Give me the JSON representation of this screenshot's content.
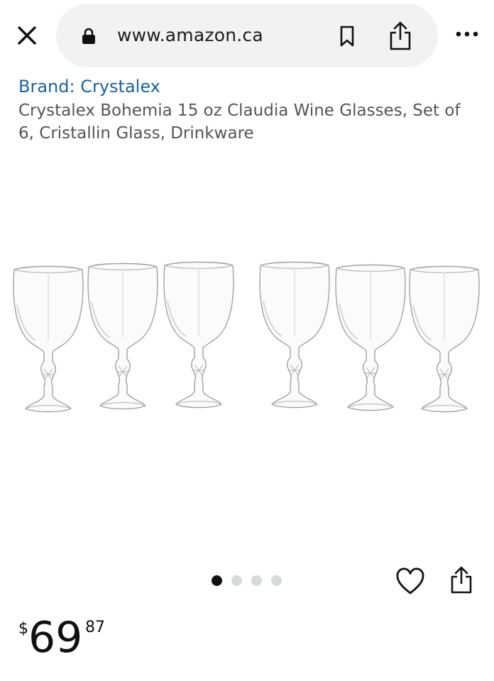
{
  "browser": {
    "url": "www.amazon.ca",
    "icons": {
      "close": "close-icon",
      "lock": "lock-icon",
      "bookmark": "bookmark-icon",
      "share": "share-icon",
      "more": "more-icon"
    }
  },
  "product": {
    "brand_link": "Brand: Crystalex",
    "title": "Crystalex Bohemia 15 oz Claudia Wine Glasses, Set of 6, Cristallin Glass, Drinkware"
  },
  "gallery": {
    "image_count": 4,
    "active_index": 0
  },
  "price": {
    "symbol": "$",
    "whole": "69",
    "fraction": "87"
  },
  "colors": {
    "link": "#1f6293",
    "text": "#0f1111",
    "url_bar_bg": "#f1f2f4"
  }
}
